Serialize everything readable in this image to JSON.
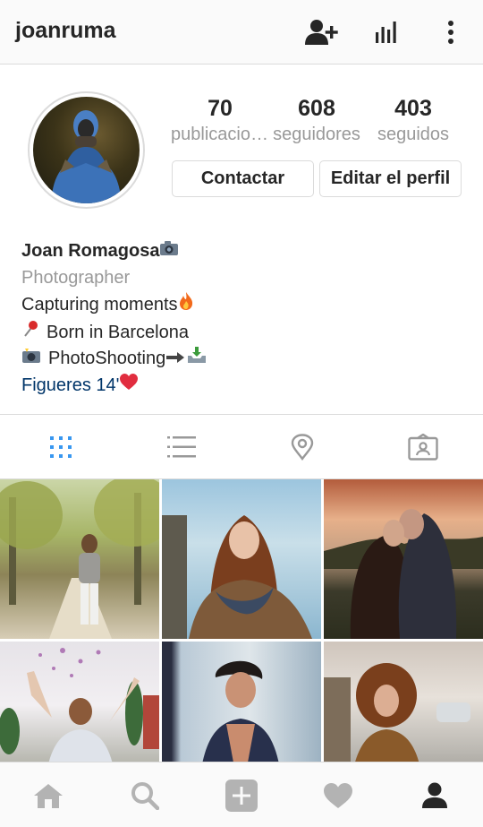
{
  "header": {
    "username": "joanruma",
    "icons": [
      "add-person-icon",
      "insights-icon",
      "more-options-icon"
    ]
  },
  "stats": [
    {
      "value": "70",
      "label": "publicaciones"
    },
    {
      "value": "608",
      "label": "seguidores"
    },
    {
      "value": "403",
      "label": "seguidos"
    }
  ],
  "actions": {
    "contact_label": "Contactar",
    "edit_label": "Editar el perfil"
  },
  "bio": {
    "name": "Joan Romagosa",
    "category": "Photographer",
    "line1": "Capturing moments",
    "line2": "Born in Barcelona",
    "line3": "PhotoShooting",
    "line4": "Figueres 14'"
  },
  "tabs": [
    "grid-icon",
    "list-icon",
    "location-pin-icon",
    "tagged-icon"
  ],
  "posts": [
    {
      "subject": "woman walking on tree-lined path"
    },
    {
      "subject": "woman with red hair and scarf by the sea"
    },
    {
      "subject": "couple kissing at sunset"
    },
    {
      "subject": "woman throwing confetti"
    },
    {
      "subject": "young man with open shirt"
    },
    {
      "subject": "curly-haired woman by a wall"
    }
  ],
  "bottom_nav": [
    "home-icon",
    "search-icon",
    "add-post-icon",
    "activity-heart-icon",
    "profile-icon"
  ],
  "colors": {
    "text": "#262626",
    "muted": "#999999",
    "link": "#003569",
    "border": "#dbdbdb",
    "bar_bg": "#fafafa",
    "active_tab": "#3897f0"
  }
}
